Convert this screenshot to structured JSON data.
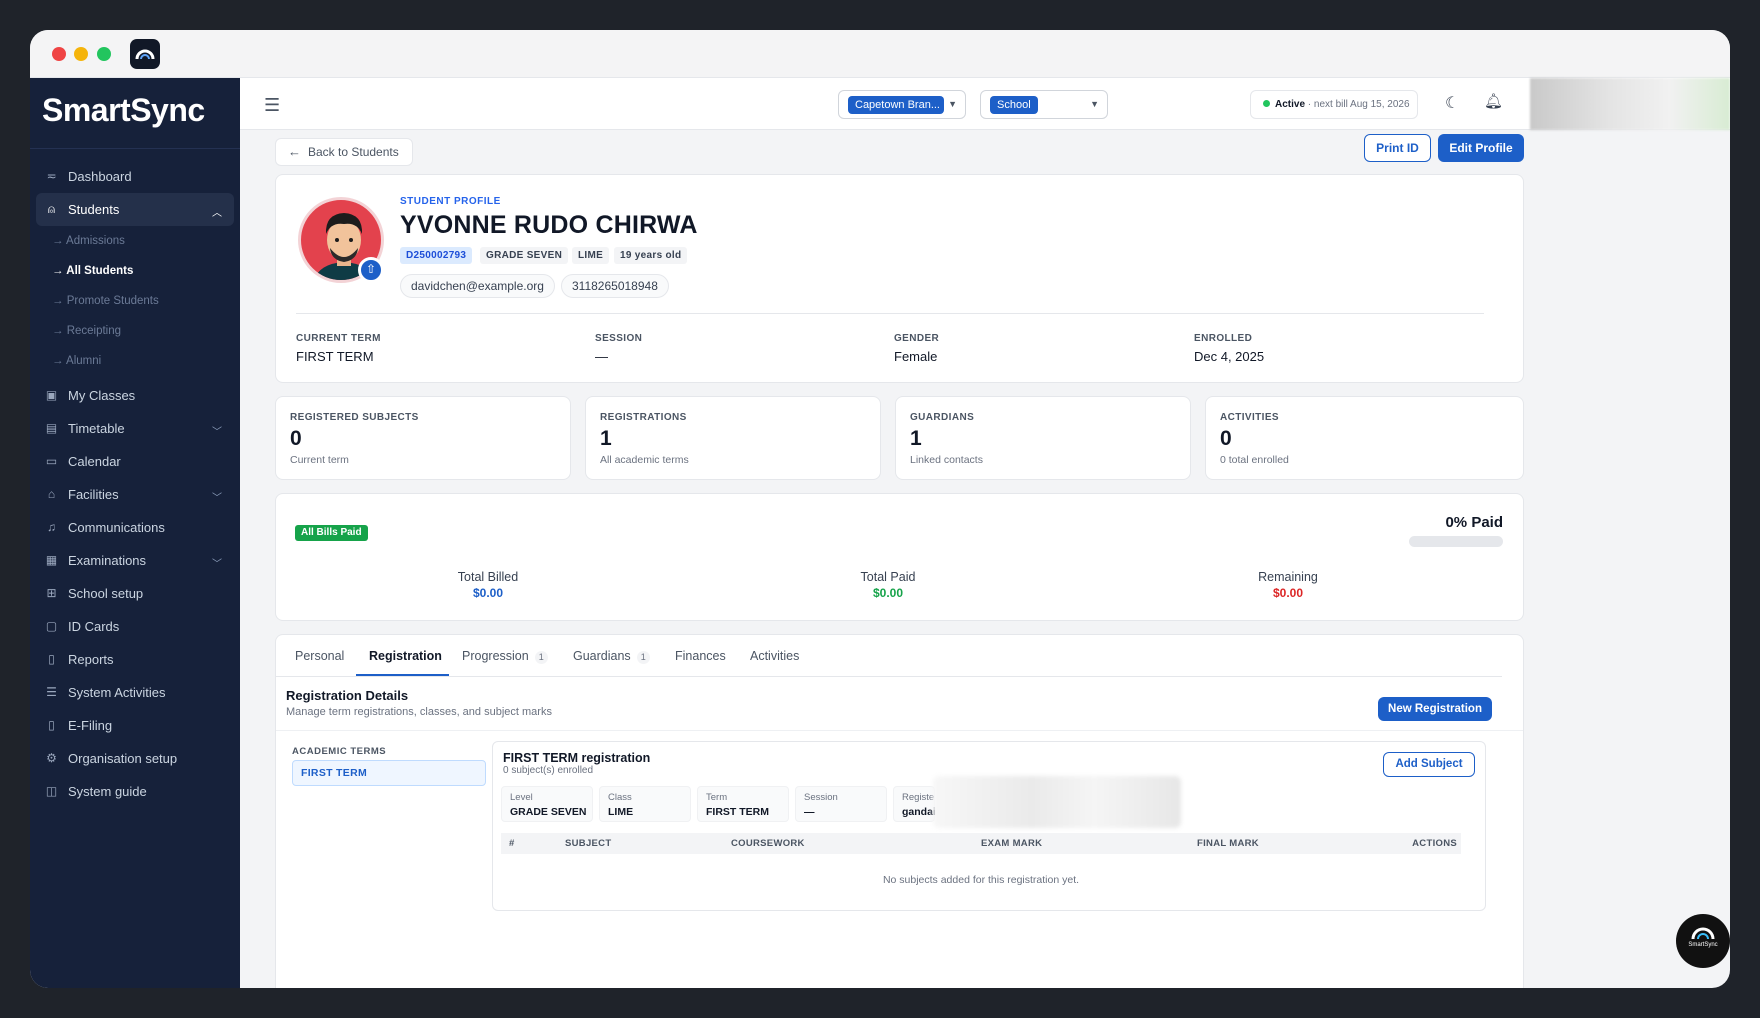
{
  "brand": {
    "logo_text_a": "Smart",
    "logo_text_b": "Sync"
  },
  "sidebar": {
    "items": [
      {
        "label": "Dashboard",
        "icon": "dashboard-icon"
      },
      {
        "label": "Students",
        "icon": "user-icon",
        "expanded": true
      },
      {
        "label": "My Classes",
        "icon": "classes-icon"
      },
      {
        "label": "Timetable",
        "icon": "timetable-icon"
      },
      {
        "label": "Calendar",
        "icon": "calendar-icon"
      },
      {
        "label": "Facilities",
        "icon": "building-icon"
      },
      {
        "label": "Communications",
        "icon": "bell-icon"
      },
      {
        "label": "Examinations",
        "icon": "exam-icon"
      },
      {
        "label": "School setup",
        "icon": "grid-icon"
      },
      {
        "label": "ID Cards",
        "icon": "id-card-icon"
      },
      {
        "label": "Reports",
        "icon": "report-icon"
      },
      {
        "label": "System Activities",
        "icon": "list-icon"
      },
      {
        "label": "E-Filing",
        "icon": "file-icon"
      },
      {
        "label": "Organisation setup",
        "icon": "gear-icon"
      },
      {
        "label": "System guide",
        "icon": "book-icon"
      }
    ],
    "students_sub": [
      {
        "label": "→ Admissions"
      },
      {
        "label": "→ All Students"
      },
      {
        "label": "→ Promote Students"
      },
      {
        "label": "→ Receipting"
      },
      {
        "label": "→ Alumni"
      }
    ]
  },
  "topbar": {
    "branch_select": "Capetown Bran...",
    "school_select": "School",
    "status_active": "Active",
    "status_bill": " · next bill Aug 15, 2026"
  },
  "actions": {
    "back": "Back to Students",
    "print_id": "Print ID",
    "edit_profile": "Edit Profile"
  },
  "profile": {
    "overline": "STUDENT PROFILE",
    "name": "YVONNE RUDO CHIRWA",
    "student_id": "D250002793",
    "grade": "GRADE SEVEN",
    "class": "LIME",
    "age": "19 years old",
    "email": "davidchen@example.org",
    "phone": "3118265018948",
    "info": [
      {
        "label": "CURRENT TERM",
        "value": "FIRST TERM"
      },
      {
        "label": "SESSION",
        "value": "—"
      },
      {
        "label": "GENDER",
        "value": "Female"
      },
      {
        "label": "ENROLLED",
        "value": "Dec 4, 2025"
      }
    ]
  },
  "stats": [
    {
      "label": "REGISTERED SUBJECTS",
      "value": "0",
      "sub": "Current term"
    },
    {
      "label": "REGISTRATIONS",
      "value": "1",
      "sub": "All academic terms"
    },
    {
      "label": "GUARDIANS",
      "value": "1",
      "sub": "Linked contacts"
    },
    {
      "label": "ACTIVITIES",
      "value": "0",
      "sub": "0 total enrolled"
    }
  ],
  "finance": {
    "badge": "All Bills Paid",
    "paid_pct_label": "0% Paid",
    "paid_fraction": 0,
    "total_billed_label": "Total Billed",
    "total_billed": "$0.00",
    "total_paid_label": "Total Paid",
    "total_paid": "$0.00",
    "remaining_label": "Remaining",
    "remaining": "$0.00",
    "colors": {
      "billed": "#1d5fc8",
      "paid": "#16a34a",
      "remaining": "#dc2626"
    }
  },
  "tabs": [
    {
      "label": "Personal"
    },
    {
      "label": "Registration",
      "active": true
    },
    {
      "label": "Progression",
      "count": "1"
    },
    {
      "label": "Guardians",
      "count": "1"
    },
    {
      "label": "Finances"
    },
    {
      "label": "Activities"
    }
  ],
  "registration": {
    "title": "Registration Details",
    "subtitle": "Manage term registrations, classes, and subject marks",
    "new_btn": "New Registration",
    "terms_heading": "ACADEMIC TERMS",
    "terms": [
      "FIRST TERM"
    ],
    "panel_title": "FIRST TERM registration",
    "panel_sub": "0 subject(s) enrolled",
    "add_subject": "Add Subject",
    "fields": [
      {
        "label": "Level",
        "value": "GRADE SEVEN"
      },
      {
        "label": "Class",
        "value": "LIME"
      },
      {
        "label": "Term",
        "value": "FIRST TERM"
      },
      {
        "label": "Session",
        "value": "—"
      },
      {
        "label": "Registe",
        "value": "gandai"
      }
    ],
    "columns": [
      "#",
      "SUBJECT",
      "COURSEWORK",
      "EXAM MARK",
      "FINAL MARK",
      "ACTIONS"
    ],
    "empty": "No subjects added for this registration yet."
  },
  "fab_label": "SmartSync",
  "accent": "#1d5fc8"
}
